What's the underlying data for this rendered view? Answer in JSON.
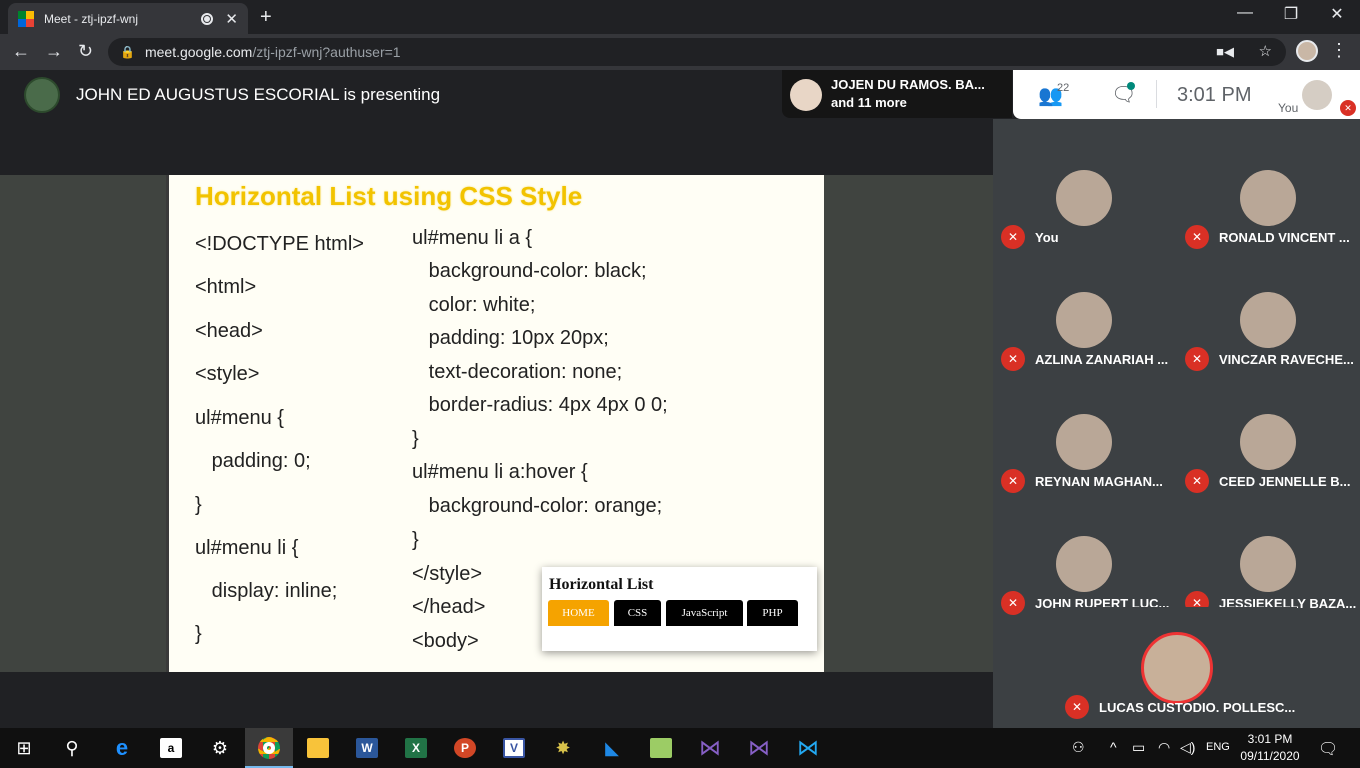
{
  "browser": {
    "tab_title": "Meet - ztj-ipzf-wnj",
    "url_host": "meet.google.com",
    "url_path": "/ztj-ipzf-wnj?authuser=1"
  },
  "meet": {
    "presenting_text": "JOHN ED AUGUSTUS ESCORIAL is presenting",
    "speaker_line1": "JOJEN DU RAMOS. BA...",
    "speaker_line2": "and 11 more",
    "people_count": "22",
    "time": "3:01  PM",
    "you_label": "You"
  },
  "slide": {
    "title": "Horizontal List using CSS Style",
    "left_code": [
      "<!DOCTYPE html>",
      "<html>",
      "<head>",
      "<style>",
      "ul#menu {",
      "   padding: 0;",
      "}",
      "ul#menu li {",
      "   display: inline;",
      "}"
    ],
    "right_code": [
      "ul#menu li a {",
      "   background-color: black;",
      "   color: white;",
      "   padding: 10px 20px;",
      "   text-decoration: none;",
      "   border-radius: 4px 4px 0 0;",
      "}",
      "ul#menu li a:hover {",
      "   background-color: orange;",
      "}",
      "</style>",
      "</head>",
      "<body>"
    ],
    "demo_title": "Horizontal List",
    "demo_buttons": [
      "HOME",
      "CSS",
      "JavaScript",
      "PHP"
    ],
    "demo_active_color": "#f5a300"
  },
  "participants": [
    {
      "name": "You"
    },
    {
      "name": "RONALD VINCENT ..."
    },
    {
      "name": "AZLINA ZANARIAH ..."
    },
    {
      "name": "VINCZAR RAVECHE..."
    },
    {
      "name": "REYNAN MAGHAN..."
    },
    {
      "name": "CEED JENNELLE B..."
    },
    {
      "name": "JOHN RUPERT LUC..."
    },
    {
      "name": "JESSIEKELLY BAZA..."
    }
  ],
  "featured_participant": "LUCAS CUSTODIO. POLLESC...",
  "taskbar": {
    "lang": "ENG",
    "time": "3:01 PM",
    "date": "09/11/2020"
  },
  "colors": {
    "mic_off": "#d93025",
    "chat_dot": "#00897b",
    "slide_title": "#f2c300"
  }
}
